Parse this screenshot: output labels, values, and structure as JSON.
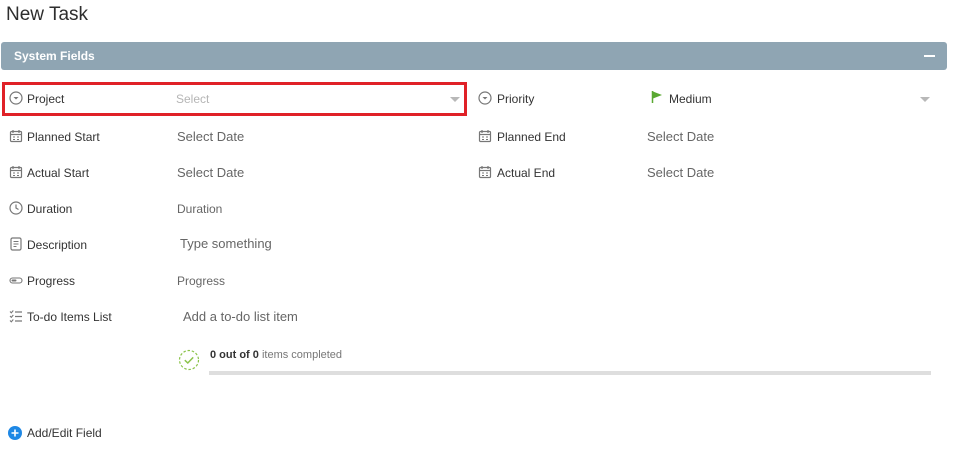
{
  "page": {
    "title": "New Task"
  },
  "section": {
    "title": "System Fields",
    "collapse_symbol": "−"
  },
  "fields": {
    "project": {
      "label": "Project",
      "placeholder": "Select"
    },
    "priority": {
      "label": "Priority",
      "value": "Medium",
      "flag_color": "#5aa832"
    },
    "planned_start": {
      "label": "Planned Start",
      "placeholder": "Select Date"
    },
    "planned_end": {
      "label": "Planned End",
      "placeholder": "Select Date"
    },
    "actual_start": {
      "label": "Actual Start",
      "placeholder": "Select Date"
    },
    "actual_end": {
      "label": "Actual End",
      "placeholder": "Select Date"
    },
    "duration": {
      "label": "Duration",
      "placeholder": "Duration"
    },
    "description": {
      "label": "Description",
      "placeholder": "Type something"
    },
    "progress": {
      "label": "Progress",
      "placeholder": "Progress"
    },
    "todo": {
      "label": "To-do Items List",
      "placeholder": "Add a to-do list item",
      "completed": "0 out of 0",
      "completed_suffix": "items completed",
      "progress_fraction": 0
    }
  },
  "footer": {
    "add_edit_label": "Add/Edit Field",
    "accent_color": "#1e88e5"
  },
  "colors": {
    "section_bar": "#8fa5b3",
    "highlight_border": "#e02127"
  }
}
